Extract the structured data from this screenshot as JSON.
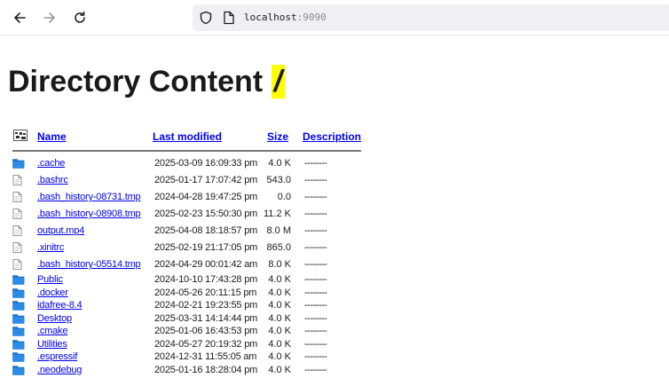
{
  "browser": {
    "url_host": "localhost",
    "url_port": ":9090"
  },
  "page": {
    "title_text": "Directory Content ",
    "title_path": "/"
  },
  "table": {
    "headers": {
      "name": "Name",
      "modified": "Last modified",
      "size": "Size",
      "description": "Description"
    },
    "rows": [
      {
        "icon": "folder-icon",
        "name": ".cache",
        "modified": "2025-03-09 16:09:33 pm",
        "size": "4.0 K",
        "description": "--------"
      },
      {
        "icon": "file-icon",
        "name": ".bashrc",
        "modified": "2025-01-17 17:07:42 pm",
        "size": "543.0",
        "description": "--------"
      },
      {
        "icon": "file-icon",
        "name": ".bash_history-08731.tmp",
        "modified": "2024-04-28 19:47:25 pm",
        "size": "0.0",
        "description": "--------"
      },
      {
        "icon": "file-icon",
        "name": ".bash_history-08908.tmp",
        "modified": "2025-02-23 15:50:30 pm",
        "size": "11.2 K",
        "description": "--------"
      },
      {
        "icon": "file-icon",
        "name": "output.mp4",
        "modified": "2025-04-08 18:18:57 pm",
        "size": "8.0 M",
        "description": "--------"
      },
      {
        "icon": "file-icon",
        "name": ".xinitrc",
        "modified": "2025-02-19 21:17:05 pm",
        "size": "865.0",
        "description": "--------"
      },
      {
        "icon": "file-icon",
        "name": ".bash_history-05514.tmp",
        "modified": "2024-04-29 00:01:42 am",
        "size": "8.0 K",
        "description": "--------"
      },
      {
        "icon": "folder-icon",
        "name": "Public",
        "modified": "2024-10-10 17:43:28 pm",
        "size": "4.0 K",
        "description": "--------"
      },
      {
        "icon": "folder-icon",
        "name": ".docker",
        "modified": "2024-05-26 20:11:15 pm",
        "size": "4.0 K",
        "description": "--------"
      },
      {
        "icon": "folder-icon",
        "name": "idafree-8.4",
        "modified": "2024-02-21 19:23:55 pm",
        "size": "4.0 K",
        "description": "--------"
      },
      {
        "icon": "folder-icon",
        "name": "Desktop",
        "modified": "2025-03-31 14:14:44 pm",
        "size": "4.0 K",
        "description": "--------"
      },
      {
        "icon": "folder-icon",
        "name": ".cmake",
        "modified": "2025-01-06 16:43:53 pm",
        "size": "4.0 K",
        "description": "--------"
      },
      {
        "icon": "folder-icon",
        "name": "Utilities",
        "modified": "2024-05-27 20:19:32 pm",
        "size": "4.0 K",
        "description": "--------"
      },
      {
        "icon": "folder-icon",
        "name": ".espressif",
        "modified": "2024-12-31 11:55:05 am",
        "size": "4.0 K",
        "description": "--------"
      },
      {
        "icon": "folder-icon",
        "name": ".neodebug",
        "modified": "2025-01-16 18:28:04 pm",
        "size": "4.0 K",
        "description": "--------"
      }
    ]
  }
}
